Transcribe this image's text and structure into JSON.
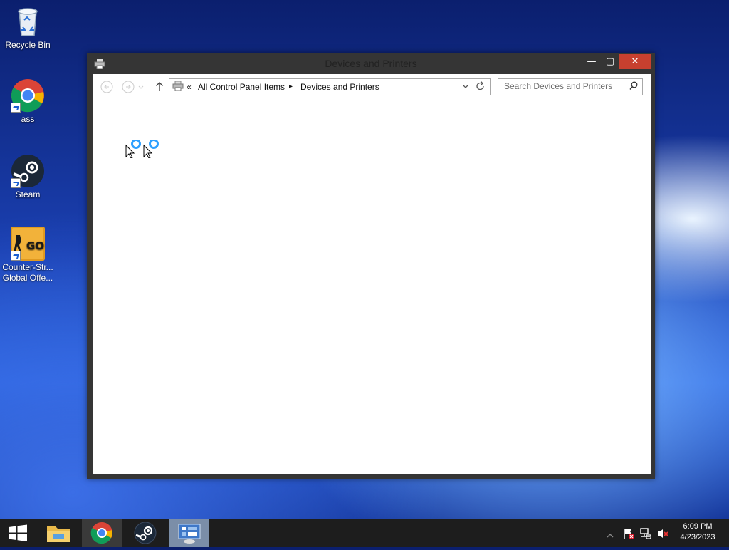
{
  "desktop": {
    "icons": [
      {
        "label": "Recycle Bin"
      },
      {
        "label": "ass"
      },
      {
        "label": "Steam"
      },
      {
        "label": "Counter-Str... Global Offe..."
      }
    ]
  },
  "window": {
    "title": "Devices and Printers",
    "minimize_glyph": "—",
    "maximize_glyph": "▢",
    "close_glyph": "✕",
    "address": {
      "overflow": "«",
      "crumbs": [
        "All Control Panel Items",
        "Devices and Printers"
      ],
      "separator": "▸"
    },
    "search": {
      "placeholder": "Search Devices and Printers"
    }
  },
  "taskbar": {
    "items": [
      "start",
      "file-explorer",
      "chrome",
      "steam",
      "devices-and-printers"
    ],
    "clock": {
      "time": "6:09 PM",
      "date": "4/23/2023"
    }
  },
  "colors": {
    "close_button": "#c7402f",
    "window_frame": "#353535",
    "taskbar": "#1d1d1d",
    "active_task": "#7b8ea8",
    "busy_ring": "#2ea0ff"
  }
}
